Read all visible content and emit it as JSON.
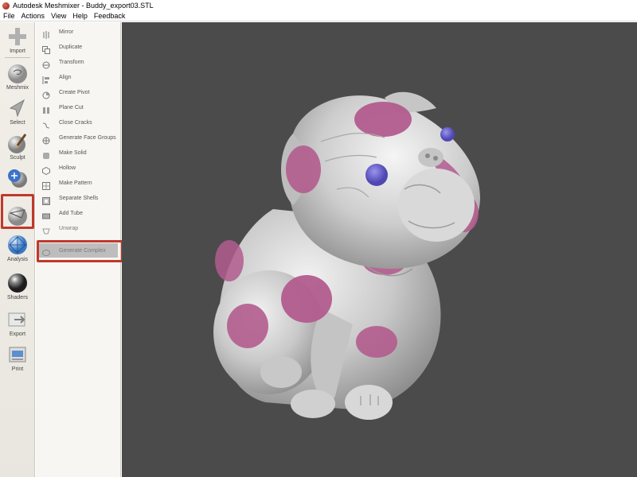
{
  "window": {
    "title": "Autodesk Meshmixer - Buddy_export03.STL",
    "app_icon": "meshmixer-logo-icon"
  },
  "menu": [
    "File",
    "Actions",
    "View",
    "Help",
    "Feedback"
  ],
  "toolbar": [
    {
      "label": "Import",
      "icon": "plus-icon"
    },
    {
      "label": "Meshmix",
      "icon": "meshmix-icon"
    },
    {
      "label": "Select",
      "icon": "select-arrow-icon"
    },
    {
      "label": "Sculpt",
      "icon": "sculpt-brush-icon"
    },
    {
      "label": "Stamp",
      "icon": "stamp-icon"
    },
    {
      "label": "Edit",
      "icon": "edit-icon"
    },
    {
      "label": "Analysis",
      "icon": "analysis-icon"
    },
    {
      "label": "Shaders",
      "icon": "shaders-icon"
    },
    {
      "label": "Export",
      "icon": "export-icon"
    },
    {
      "label": "Print",
      "icon": "print-icon"
    }
  ],
  "edit_menu": [
    {
      "label": "Mirror",
      "icon": "mirror-icon"
    },
    {
      "label": "Duplicate",
      "icon": "duplicate-icon"
    },
    {
      "label": "Transform",
      "icon": "transform-icon"
    },
    {
      "label": "Align",
      "icon": "align-icon"
    },
    {
      "label": "Create Pivot",
      "icon": "pivot-icon"
    },
    {
      "label": "Plane Cut",
      "icon": "plane-cut-icon"
    },
    {
      "label": "Close Cracks",
      "icon": "close-cracks-icon"
    },
    {
      "label": "Generate Face Groups",
      "icon": "face-groups-icon"
    },
    {
      "label": "Make Solid",
      "icon": "make-solid-icon"
    },
    {
      "label": "Hollow",
      "icon": "hollow-icon"
    },
    {
      "label": "Make Pattern",
      "icon": "pattern-icon"
    },
    {
      "label": "Separate Shells",
      "icon": "shells-icon"
    },
    {
      "label": "Add Tube",
      "icon": "tube-icon"
    },
    {
      "label": "Unwrap",
      "icon": "unwrap-icon"
    },
    {
      "label": "Generate Complex",
      "icon": "complex-icon"
    }
  ],
  "colors": {
    "highlight": "#c0392b",
    "viewport": "#4b4b4b",
    "spots": "#b25c8e",
    "eyes": "#6a62c9"
  }
}
